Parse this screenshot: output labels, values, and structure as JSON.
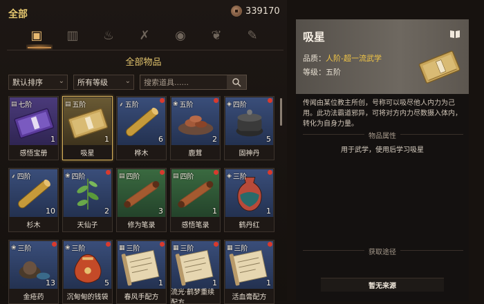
{
  "header": {
    "title": "全部",
    "currency_icon": "coin-icon",
    "currency_value": "339170"
  },
  "categories": [
    {
      "name": "chest-icon",
      "glyph": "▣",
      "active": true
    },
    {
      "name": "scroll-icon",
      "glyph": "▥"
    },
    {
      "name": "flame-icon",
      "glyph": "♨"
    },
    {
      "name": "swords-icon",
      "glyph": "✗"
    },
    {
      "name": "eye-icon",
      "glyph": "◉"
    },
    {
      "name": "leaf-icon",
      "glyph": "❦"
    },
    {
      "name": "brush-icon",
      "glyph": "✎"
    }
  ],
  "section_title": "全部物品",
  "filters": {
    "sort": "默认排序",
    "grade": "所有等级",
    "search_placeholder": "搜索道具......"
  },
  "items": [
    {
      "grade": "七阶",
      "name": "感悟宝册",
      "count": "1",
      "bg": "bg-purple",
      "art": "book-purple",
      "icon": "book-icon"
    },
    {
      "grade": "五阶",
      "name": "吸星",
      "count": "1",
      "bg": "bg-gold",
      "art": "book-gold",
      "icon": "book-icon",
      "selected": true
    },
    {
      "grade": "五阶",
      "name": "桦木",
      "count": "6",
      "bg": "bg-blue",
      "art": "log",
      "icon": "wheat-icon",
      "dot": true
    },
    {
      "grade": "五阶",
      "name": "鹿茸",
      "count": "2",
      "bg": "bg-blue",
      "art": "plate",
      "icon": "herb-icon",
      "dot": true
    },
    {
      "grade": "四阶",
      "name": "固神丹",
      "count": "5",
      "bg": "bg-blue",
      "art": "pot",
      "icon": "pill-icon",
      "dot": true
    },
    {
      "grade": "四阶",
      "name": "杉木",
      "count": "10",
      "bg": "bg-blue",
      "art": "log",
      "icon": "wheat-icon"
    },
    {
      "grade": "四阶",
      "name": "天仙子",
      "count": "2",
      "bg": "bg-blue",
      "art": "plant",
      "icon": "herb-icon",
      "dot": true
    },
    {
      "grade": "四阶",
      "name": "修为笔录",
      "count": "3",
      "bg": "bg-green",
      "art": "scroll",
      "icon": "book-icon",
      "dot": true
    },
    {
      "grade": "四阶",
      "name": "感悟笔录",
      "count": "1",
      "bg": "bg-green",
      "art": "scroll",
      "icon": "book-icon",
      "dot": true
    },
    {
      "grade": "三阶",
      "name": "鹤丹红",
      "count": "1",
      "bg": "bg-blue",
      "art": "vase",
      "icon": "pill-icon",
      "dot": true
    },
    {
      "grade": "三阶",
      "name": "金疮药",
      "count": "13",
      "bg": "bg-blue",
      "art": "pouch",
      "icon": "herb-icon",
      "dot": true
    },
    {
      "grade": "三阶",
      "name": "沉甸甸的钱袋",
      "count": "5",
      "bg": "bg-blue",
      "art": "bag",
      "icon": "herb-icon",
      "dot": true
    },
    {
      "grade": "三阶",
      "name": "春风手配方",
      "count": "1",
      "bg": "bg-blue",
      "art": "paper",
      "icon": "recipe-icon",
      "dot": true
    },
    {
      "grade": "三阶",
      "name": "流光·鹤梦重续配方",
      "count": "1",
      "bg": "bg-blue",
      "art": "paper",
      "icon": "recipe-icon",
      "dot": true
    },
    {
      "grade": "三阶",
      "name": "活血膏配方",
      "count": "1",
      "bg": "bg-blue",
      "art": "paper",
      "icon": "recipe-icon",
      "dot": true
    }
  ],
  "detail": {
    "name": "吸星",
    "icon": "book-icon",
    "quality_label": "品质：",
    "quality_value": "人阶-超一流武学",
    "level_label": "等级：",
    "level_value": "五阶",
    "description": "传闻由某位教主所创，号称可以吸尽他人内力为己用。此功法霸道邪异，可将对方内力尽数摄入体内，转化为自身力量。",
    "props_label": "物品属性",
    "props_text": "用于武学，使用后学习吸星",
    "source_label": "获取途径",
    "source_value": "暂无来源"
  }
}
